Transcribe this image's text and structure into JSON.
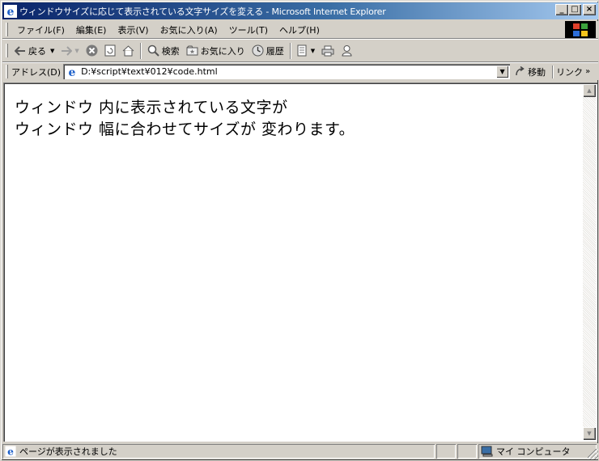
{
  "window": {
    "title": "ウィンドウサイズに応じて表示されている文字サイズを変える - Microsoft Internet Explorer"
  },
  "title_buttons": {
    "minimize": "_",
    "maximize": "□",
    "close": "×"
  },
  "menubar": {
    "items": [
      {
        "label": "ファイル(F)"
      },
      {
        "label": "編集(E)"
      },
      {
        "label": "表示(V)"
      },
      {
        "label": "お気に入り(A)"
      },
      {
        "label": "ツール(T)"
      },
      {
        "label": "ヘルプ(H)"
      }
    ]
  },
  "toolbar": {
    "back_label": "戻る",
    "search_label": "検索",
    "favorites_label": "お気に入り",
    "history_label": "履歴"
  },
  "addressbar": {
    "label": "アドレス(D)",
    "value": "D:¥script¥text¥012¥code.html",
    "go_label": "移動",
    "links_label": "リンク"
  },
  "content": {
    "lines": [
      "ウィンドウ 内に表示されている文字が",
      "ウィンドウ 幅に合わせてサイズが 変わります。"
    ]
  },
  "statusbar": {
    "message": "ページが表示されました",
    "zone": "マイ コンピュータ"
  },
  "colors": {
    "titlebar_start": "#0a246a",
    "titlebar_end": "#a6caf0",
    "chrome": "#d4d0c8"
  }
}
